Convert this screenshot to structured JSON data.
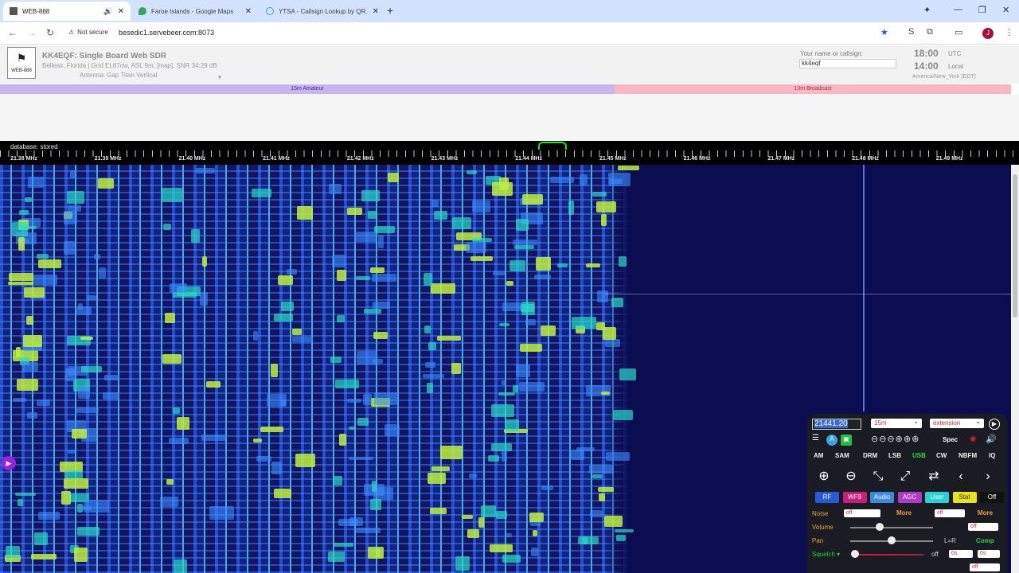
{
  "browser": {
    "tabs": [
      {
        "title": "WEB-888",
        "active": true
      },
      {
        "title": "Faroe Islands - Google Maps",
        "active": false
      },
      {
        "title": "YTSA - Callsign Lookup by QR...",
        "active": false
      }
    ],
    "security_label": "Not secure",
    "url": "besedic1.servebeer.com:8073",
    "profile_initial": "J"
  },
  "sdr": {
    "logo_text": "WEB-888",
    "title": "KK4EQF: Single Board Web SDR",
    "location": "Belleair, Florida | Grid EL87ow, ASL 9m, [map], SNR 34:29 dB",
    "antenna": "Antenna: Gap Titan Vertical",
    "ident_label": "Your name or callsign:",
    "ident_value": "kk4eqf",
    "utc_time": "18:00",
    "utc_label": "UTC",
    "local_time": "14:00",
    "local_label": "Local",
    "timezone": "America/New_York (EDT)"
  },
  "bands": [
    {
      "label": "15m Amateur",
      "color": "#c9b5f0",
      "text_color": "#3a2a90"
    },
    {
      "label": "13m Broadcast",
      "color": "#f7b8c4",
      "text_color": "#b03040"
    }
  ],
  "scale": {
    "database_label": "database: stored",
    "ticks": [
      "21.38 MHz",
      "21.39 MHz",
      "21.40 MHz",
      "21.41 MHz",
      "21.42 MHz",
      "21.43 MHz",
      "21.44 MHz",
      "21.45 MHz",
      "21.46 MHz",
      "21.47 MHz",
      "21.48 MHz",
      "21.49 MHz"
    ]
  },
  "panel": {
    "frequency": "21441.20",
    "band_select": "15m",
    "extension_select": "extension",
    "spec_label": "Spec",
    "modes": [
      "AM",
      "SAM",
      "DRM",
      "LSB",
      "USB",
      "CW",
      "NBFM",
      "IQ"
    ],
    "active_mode": "USB",
    "tabs": [
      {
        "label": "RF",
        "bg": "#2a5bd7",
        "fg": "#ffffff"
      },
      {
        "label": "WF9",
        "bg": "#c8207a",
        "fg": "#ffffff"
      },
      {
        "label": "Audio",
        "bg": "#3a8ae0",
        "fg": "#ffffff"
      },
      {
        "label": "AGC",
        "bg": "#b03ac8",
        "fg": "#ffffff"
      },
      {
        "label": "User",
        "bg": "#2ad0d8",
        "fg": "#ffffff"
      },
      {
        "label": "Stat",
        "bg": "#e8e020",
        "fg": "#333333"
      },
      {
        "label": "Off",
        "bg": "#111111",
        "fg": "#ffffff"
      }
    ],
    "noise_label": "Noise",
    "noise_select": "off",
    "noise_more": "More",
    "noise2_select": "off",
    "noise2_more": "More",
    "volume_label": "Volume",
    "volume_level": 0.36,
    "volume_select": "off",
    "pan_label": "Pan",
    "pan_value": "L=R",
    "pan_level": 0.5,
    "comp_label": "Comp",
    "squelch_label": "Squelch",
    "squelch_level": 0.02,
    "squelch_off": "off",
    "squelch_sel1": "0s",
    "squelch_sel2": "0s",
    "bottom_select": "off"
  }
}
